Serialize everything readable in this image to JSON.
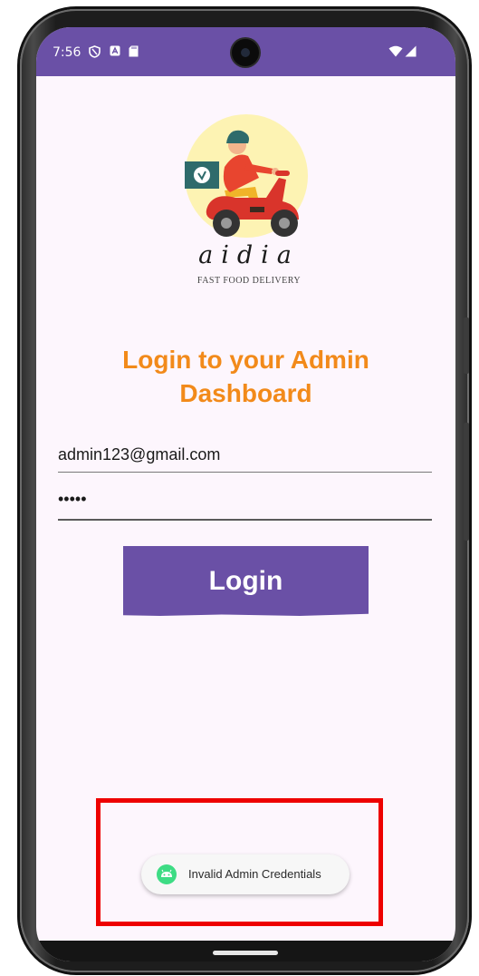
{
  "status_bar": {
    "time": "7:56",
    "icons": [
      "shield-icon",
      "a-notification-icon",
      "sd-card-icon",
      "wifi-icon",
      "signal-icon"
    ]
  },
  "logo": {
    "brand": "aidia",
    "tagline": "FAST FOOD DELIVERY"
  },
  "login": {
    "title": "Login to your Admin Dashboard",
    "email_value": "admin123@gmail.com",
    "password_value": "•••••",
    "button_label": "Login"
  },
  "toast": {
    "message": "Invalid Admin Credentials",
    "icon": "android-icon"
  },
  "colors": {
    "status_bar": "#6a50a6",
    "accent_orange": "#f28a1a",
    "button": "#6a50a6",
    "screen_background": "#fdf6fd",
    "highlight": "#ee0000"
  }
}
